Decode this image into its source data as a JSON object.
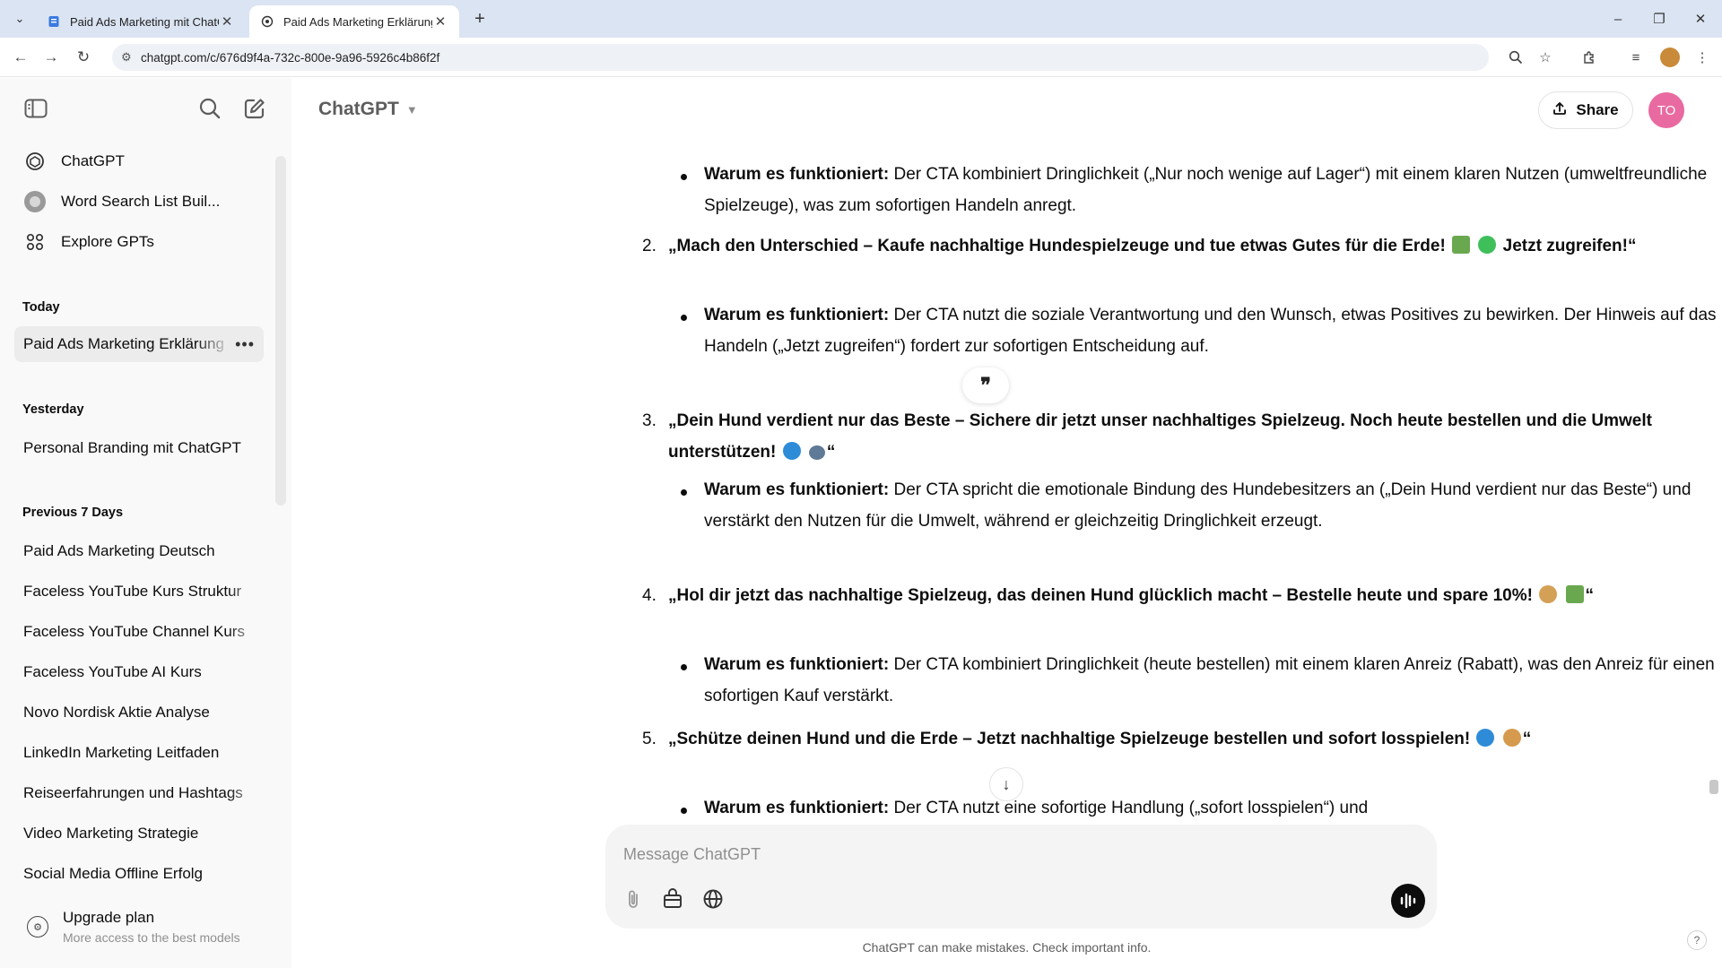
{
  "browser": {
    "tabs": [
      {
        "title": "Paid Ads Marketing mit ChatGPT",
        "active": false
      },
      {
        "title": "Paid Ads Marketing Erklärung",
        "active": true
      }
    ],
    "url": "chatgpt.com/c/676d9f4a-732c-800e-9a96-5926c4b86f2f"
  },
  "sidebar": {
    "top_items": [
      {
        "label": "ChatGPT",
        "icon": "openai-logo-icon"
      },
      {
        "label": "Word Search List Buil...",
        "icon": "gpt-avatar-icon"
      },
      {
        "label": "Explore GPTs",
        "icon": "grid-icon"
      }
    ],
    "sections": [
      {
        "title": "Today",
        "items": [
          "Paid Ads Marketing Erklärung"
        ]
      },
      {
        "title": "Yesterday",
        "items": [
          "Personal Branding mit ChatGPT"
        ]
      },
      {
        "title": "Previous 7 Days",
        "items": [
          "Paid Ads Marketing Deutsch",
          "Faceless YouTube Kurs Struktur",
          "Faceless YouTube Channel Kurs",
          "Faceless YouTube AI Kurs",
          "Novo Nordisk Aktie Analyse",
          "LinkedIn Marketing Leitfaden",
          "Reiseerfahrungen und Hashtags",
          "Video Marketing Strategie",
          "Social Media Offline Erfolg"
        ]
      }
    ],
    "upgrade": {
      "title": "Upgrade plan",
      "subtitle": "More access to the best models"
    }
  },
  "header": {
    "model": "ChatGPT",
    "share_label": "Share",
    "avatar_initials": "TO"
  },
  "chat": {
    "intro_bullet": {
      "label": "Warum es funktioniert:",
      "text": " Der CTA kombiniert Dringlichkeit („Nur noch wenige auf Lager“) mit einem klaren Nutzen (umweltfreundliche Spielzeuge), was zum sofortigen Handeln anregt."
    },
    "items": [
      {
        "number": "2.",
        "headline": "„Mach den Unterschied – Kaufe nachhaltige Hundespielzeuge und tue etwas Gutes für die Erde!",
        "headline_tail": " Jetzt zugreifen!“",
        "reason_label": "Warum es funktioniert:",
        "reason": " Der CTA nutzt die soziale Verantwortung und den Wunsch, etwas Positives zu bewirken. Der Hinweis auf das Handeln („Jetzt zugreifen“) fordert zur sofortigen Entscheidung auf."
      },
      {
        "number": "3.",
        "headline": "„Dein Hund verdient nur das Beste – Sichere dir jetzt unser nachhaltiges Spielzeug. Noch heute bestellen und die Umwelt unterstützen!",
        "headline_tail": "“",
        "reason_label": "Warum es funktioniert:",
        "reason": " Der CTA spricht die emotionale Bindung des Hundebesitzers an („Dein Hund verdient nur das Beste“) und verstärkt den Nutzen für die Umwelt, während er gleichzeitig Dringlichkeit erzeugt."
      },
      {
        "number": "4.",
        "headline": "„Hol dir jetzt das nachhaltige Spielzeug, das deinen Hund glücklich macht – Bestelle heute und spare 10%!",
        "headline_tail": "“",
        "reason_label": "Warum es funktioniert:",
        "reason": " Der CTA kombiniert Dringlichkeit (heute bestellen) mit einem klaren Anreiz (Rabatt), was den Anreiz für einen sofortigen Kauf verstärkt."
      },
      {
        "number": "5.",
        "headline": "„Schütze deinen Hund und die Erde – Jetzt nachhaltige Spielzeuge bestellen und sofort losspielen!",
        "headline_tail": "“",
        "reason_label": "Warum es funktioniert:",
        "reason": " Der CTA nutzt eine sofortige Handlung („sofort losspielen“) und"
      }
    ]
  },
  "composer": {
    "placeholder": "Message ChatGPT"
  },
  "footer": "ChatGPT can make mistakes. Check important info.",
  "colors": {
    "accent_avatar": "#e96aa0",
    "sidebar_bg": "#f9f9f9",
    "composer_bg": "#f4f4f4"
  }
}
